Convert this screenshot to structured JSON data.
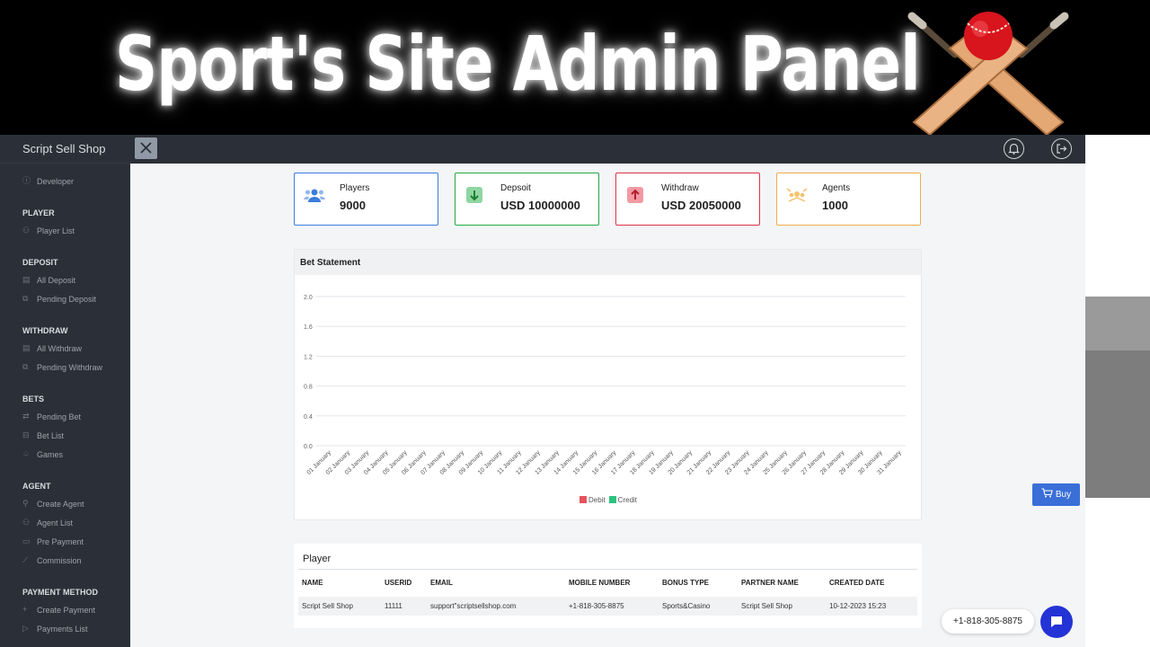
{
  "banner": {
    "title": "Sport's Site Admin Panel"
  },
  "sidebar": {
    "brand": "Script Sell Shop",
    "developer": "Developer",
    "sections": [
      {
        "title": "PLAYER",
        "items": [
          "Player List"
        ]
      },
      {
        "title": "DEPOSIT",
        "items": [
          "All Deposit",
          "Pending Deposit"
        ]
      },
      {
        "title": "WITHDRAW",
        "items": [
          "All Withdraw",
          "Pending Withdraw"
        ]
      },
      {
        "title": "BETS",
        "items": [
          "Pending Bet",
          "Bet List",
          "Games"
        ]
      },
      {
        "title": "AGENT",
        "items": [
          "Create Agent",
          "Agent List",
          "Pre Payment",
          "Commission"
        ]
      },
      {
        "title": "PAYMENT METHOD",
        "items": [
          "Create Payment",
          "Payments List"
        ]
      }
    ]
  },
  "topbar": {
    "icons": [
      "close-icon",
      "bell-icon",
      "logout-icon"
    ]
  },
  "cards": [
    {
      "label": "Players",
      "value": "9000",
      "color": "#3b7ddd",
      "icon": "users-icon"
    },
    {
      "label": "Depsoit",
      "value": "USD 10000000",
      "color": "#28a745",
      "icon": "arrow-down-icon"
    },
    {
      "label": "Withdraw",
      "value": "USD 20050000",
      "color": "#dc3545",
      "icon": "arrow-up-icon"
    },
    {
      "label": "Agents",
      "value": "1000",
      "color": "#f0ad4e",
      "icon": "agents-icon"
    }
  ],
  "bet_statement": {
    "title": "Bet Statement"
  },
  "chart_data": {
    "type": "bar",
    "title": "Bet Statement",
    "categories": [
      "01 January",
      "02 January",
      "03 January",
      "04 January",
      "05 January",
      "06 January",
      "07 January",
      "08 January",
      "09 January",
      "10 January",
      "11 January",
      "12 January",
      "13 January",
      "14 January",
      "15 January",
      "16 January",
      "17 January",
      "18 January",
      "19 January",
      "20 January",
      "21 January",
      "22 January",
      "23 January",
      "24 January",
      "25 January",
      "26 January",
      "27 January",
      "28 January",
      "29 January",
      "30 January",
      "31 January"
    ],
    "yticks": [
      "0.0",
      "0.4",
      "0.8",
      "1.2",
      "1.6",
      "2.0"
    ],
    "ylim": [
      0,
      2.0
    ],
    "grid": true,
    "legend_position": "bottom",
    "series": [
      {
        "name": "Debit",
        "color": "#e5535d",
        "values": [
          0,
          0,
          0,
          0,
          0,
          0,
          0,
          0,
          0,
          0,
          0,
          0,
          0,
          0,
          0,
          0,
          0,
          0,
          0,
          0,
          0,
          0,
          0,
          0,
          0,
          0,
          0,
          0,
          0,
          0,
          0
        ]
      },
      {
        "name": "Credit",
        "color": "#2ec27e",
        "values": [
          0,
          0,
          0,
          0,
          0,
          0,
          0,
          0,
          0,
          0,
          0,
          0,
          0,
          0,
          0,
          0,
          0,
          0,
          0,
          0,
          0,
          0,
          0,
          0,
          0,
          0,
          0,
          0,
          0,
          0,
          0
        ]
      }
    ]
  },
  "player_table": {
    "title": "Player",
    "headers": [
      "NAME",
      "USERID",
      "EMAIL",
      "MOBILE NUMBER",
      "BONUS TYPE",
      "PARTNER NAME",
      "CREATED DATE"
    ],
    "rows": [
      [
        "Script Sell Shop",
        "11111",
        "support\"scriptsellshop.com",
        "+1-818-305-8875",
        "Sports&Casino",
        "Script Sell Shop",
        "10-12-2023 15:23"
      ]
    ]
  },
  "buy_label": "Buy",
  "contact_phone": "+1-818-305-8875"
}
